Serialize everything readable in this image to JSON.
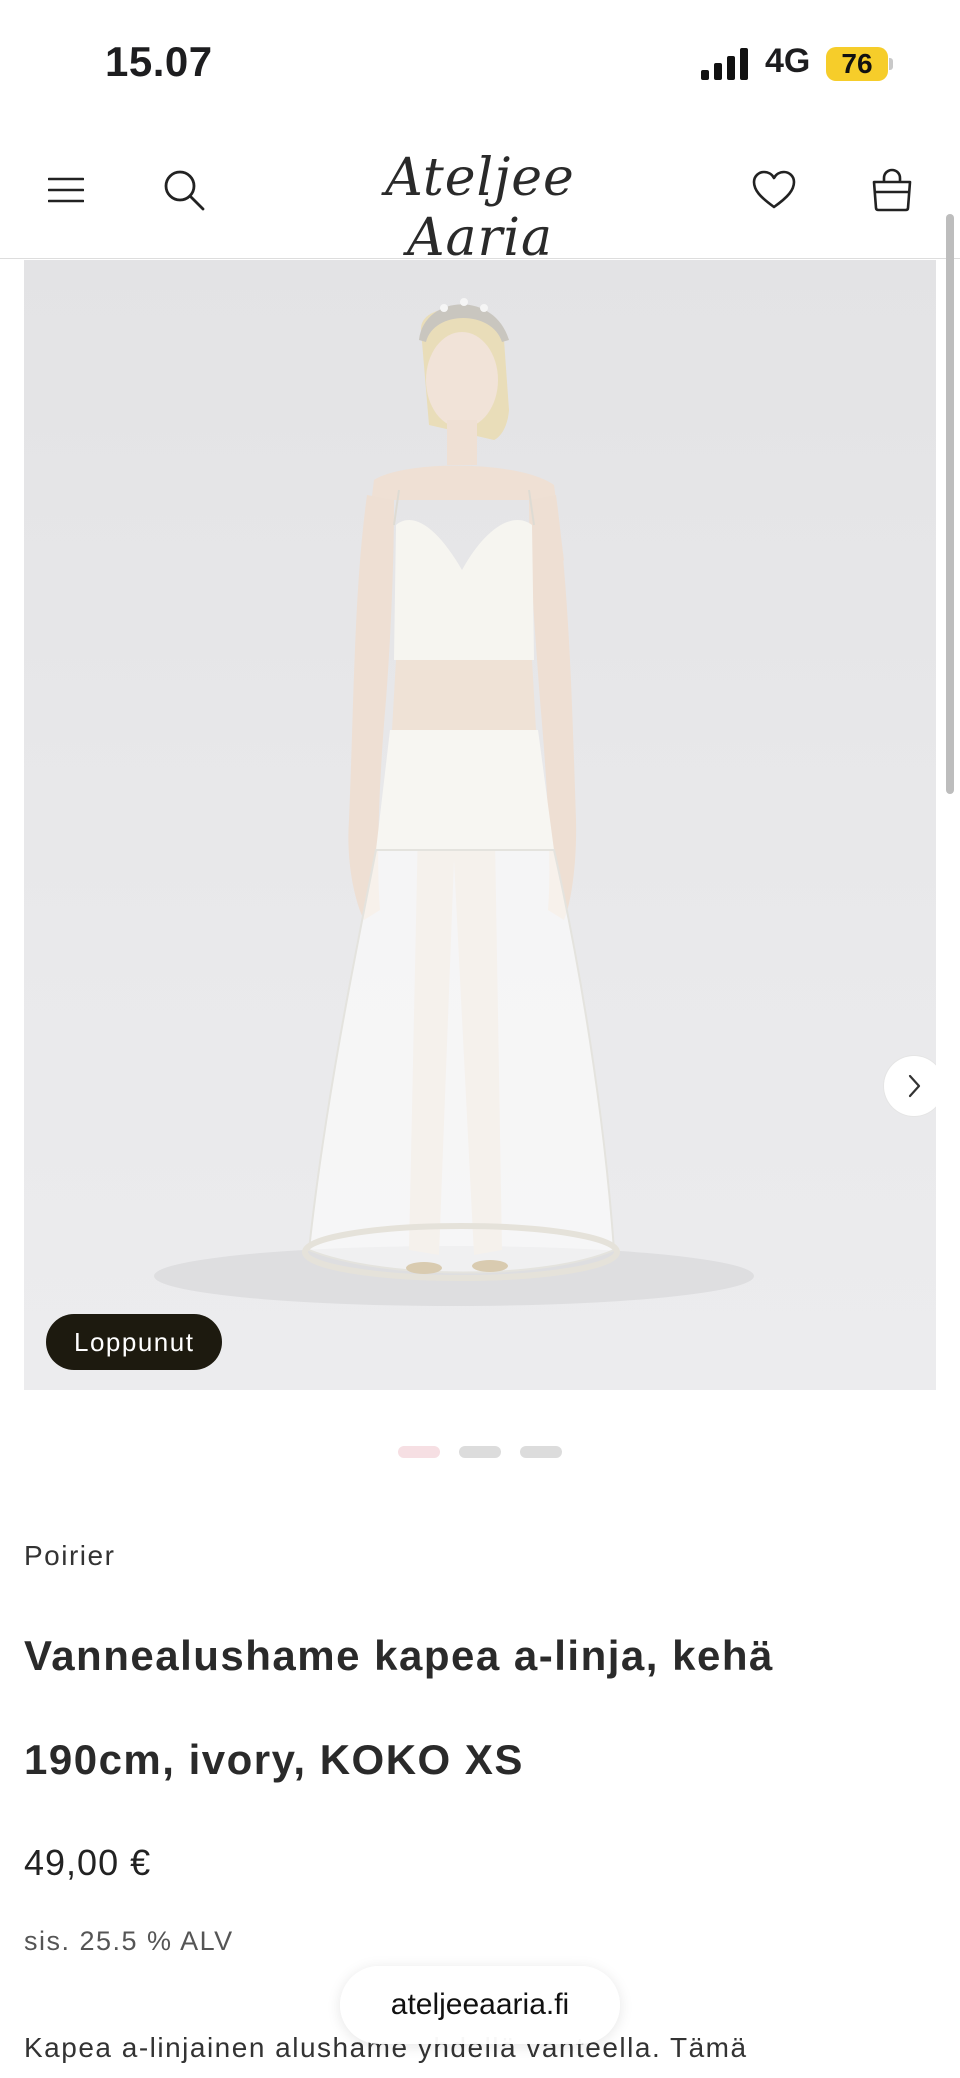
{
  "status_bar": {
    "time": "15.07",
    "network": "4G",
    "battery": "76",
    "battery_color": "#f6cd2a"
  },
  "header": {
    "logo": "Ateljee Aaria",
    "icons": [
      "menu-icon",
      "search-icon",
      "heart-icon",
      "bag-icon"
    ]
  },
  "gallery": {
    "badge": "Loppunut",
    "next_icon": "chevron-right-icon",
    "slide_count": 3,
    "active_slide": 1,
    "active_dot_color": "#f6dfe3"
  },
  "product": {
    "vendor": "Poirier",
    "title_line1": "Vannealushame kapea a-linja, kehä",
    "title_line2": "190cm, ivory, KOKO XS",
    "price": "49,00 €",
    "tax": "sis. 25.5 % ALV",
    "description": "Kapea a-linjainen alushame yhdellä vanteella. Tämä"
  },
  "browser": {
    "url": "ateljeeaaria.fi"
  }
}
